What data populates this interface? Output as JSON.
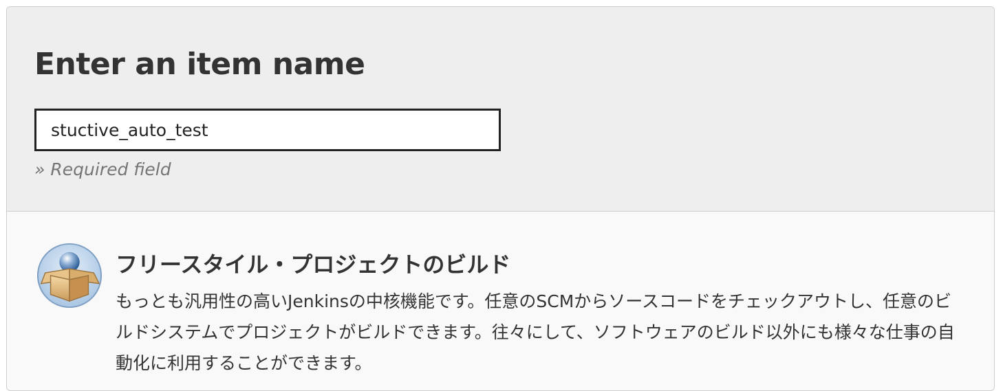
{
  "form": {
    "title": "Enter an item name",
    "item_name_value": "stuctive_auto_test",
    "required_hint": "» Required field"
  },
  "item_types": [
    {
      "icon": "freestyle-project-box-icon",
      "title": "フリースタイル・プロジェクトのビルド",
      "description": "もっとも汎用性の高いJenkinsの中核機能です。任意のSCMからソースコードをチェックアウトし、任意のビルドシステムでプロジェクトがビルドできます。往々にして、ソフトウェアのビルド以外にも様々な仕事の自動化に利用することができます。"
    }
  ]
}
